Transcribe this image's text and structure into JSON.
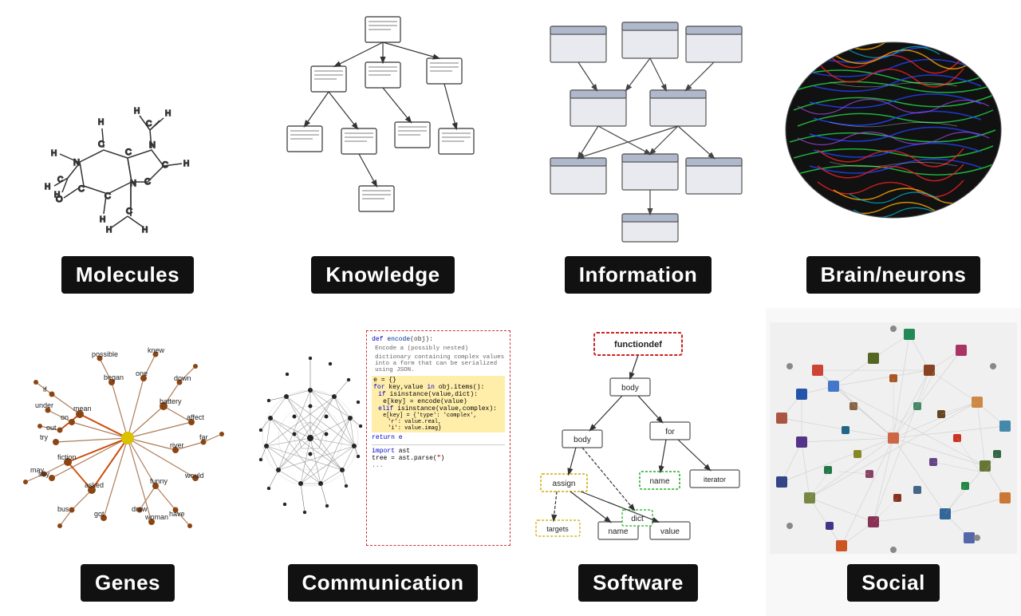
{
  "cells": [
    {
      "id": "molecules",
      "label": "Molecules",
      "row": 1,
      "col": 1
    },
    {
      "id": "knowledge",
      "label": "Knowledge",
      "row": 1,
      "col": 2
    },
    {
      "id": "information",
      "label": "Information",
      "row": 1,
      "col": 3
    },
    {
      "id": "brain",
      "label": "Brain/neurons",
      "row": 1,
      "col": 4
    },
    {
      "id": "genes",
      "label": "Genes",
      "row": 2,
      "col": 1
    },
    {
      "id": "communication",
      "label": "Communication",
      "row": 2,
      "col": 2
    },
    {
      "id": "software",
      "label": "Software",
      "row": 2,
      "col": 3
    },
    {
      "id": "social",
      "label": "Social",
      "row": 2,
      "col": 4
    }
  ],
  "labels": {
    "molecules": "Molecules",
    "knowledge": "Knowledge",
    "information": "Information",
    "brain": "Brain/neurons",
    "genes": "Genes",
    "communication": "Communication",
    "software": "Software",
    "social": "Social"
  }
}
